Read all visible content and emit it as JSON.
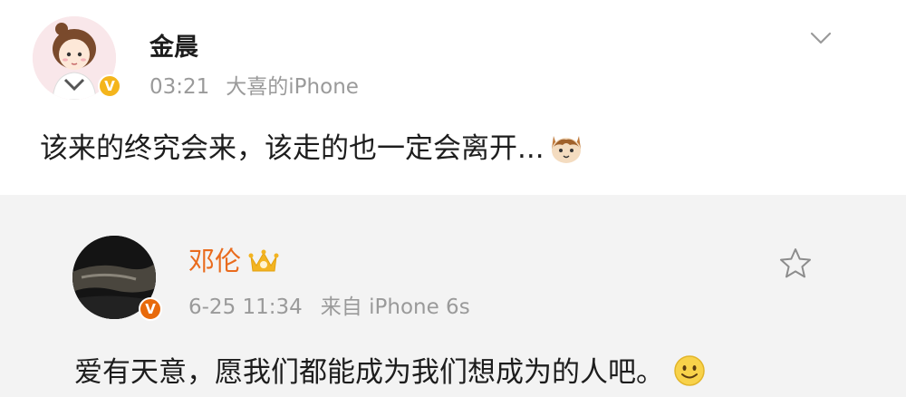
{
  "post": {
    "author": "金晨",
    "time": "03:21",
    "source": "大喜的iPhone",
    "text": "该来的终究会来，该走的也一定会离开...",
    "verified_icon": "verified-badge-icon",
    "menu_icon": "chevron-down-icon",
    "emoji_icon": "cat-face-emoji-icon"
  },
  "reposted": {
    "author": "邓伦",
    "date_time": "6-25 11:34",
    "source": "来自 iPhone 6s",
    "text": "爱有天意，愿我们都能成为我们想成为的人吧。",
    "crown_icon": "vip-crown-icon",
    "verified_icon": "verified-badge-icon",
    "favorite_icon": "star-icon",
    "emoji_icon": "smile-emoji-icon"
  },
  "colors": {
    "author_highlight": "#e96b1d",
    "meta_gray": "#9a9a9a",
    "verified_yellow": "#f4b51c",
    "verified_orange": "#e86a0b",
    "card_bg": "#f3f3f3"
  }
}
